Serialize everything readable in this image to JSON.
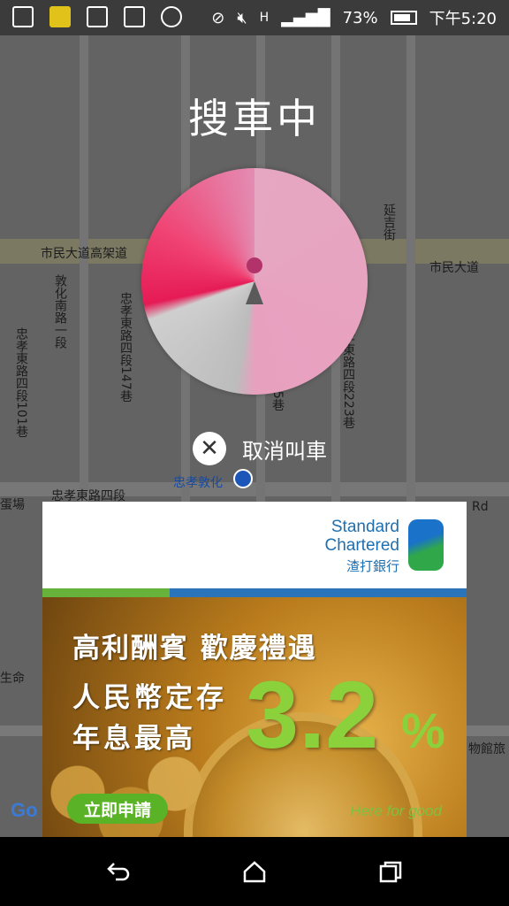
{
  "status_bar": {
    "battery": "73%",
    "time": "下午5:20"
  },
  "map": {
    "labels": [
      "市民大道高架道",
      "市民大道",
      "延吉街",
      "敦化南路一段",
      "忠孝東路四段101巷",
      "忠孝東路四段147巷",
      "忠孝東路四段",
      "忠孝敦化",
      "忠孝東路四段205巷",
      "忠孝東路四段223巷",
      "蛋場",
      "Rd",
      "生命",
      "物館旅"
    ]
  },
  "overlay": {
    "title": "搜車中",
    "cancel_label": "取消叫車"
  },
  "ad": {
    "brand_en_1": "Standard",
    "brand_en_2": "Chartered",
    "brand_zh": "渣打銀行",
    "headline": "高利酬賓 歡慶禮遇",
    "line2": "人民幣定存",
    "line3": "年息最高",
    "rate": "3.2",
    "percent": "%",
    "cta": "立即申請",
    "tagline": "Here for good",
    "colors": {
      "brand_blue": "#1e6fb0",
      "accent_green": "#8bd13c"
    }
  },
  "map_watermark": "Go",
  "navbar": {
    "icons": [
      "back-icon",
      "home-icon",
      "recent-apps-icon"
    ]
  }
}
